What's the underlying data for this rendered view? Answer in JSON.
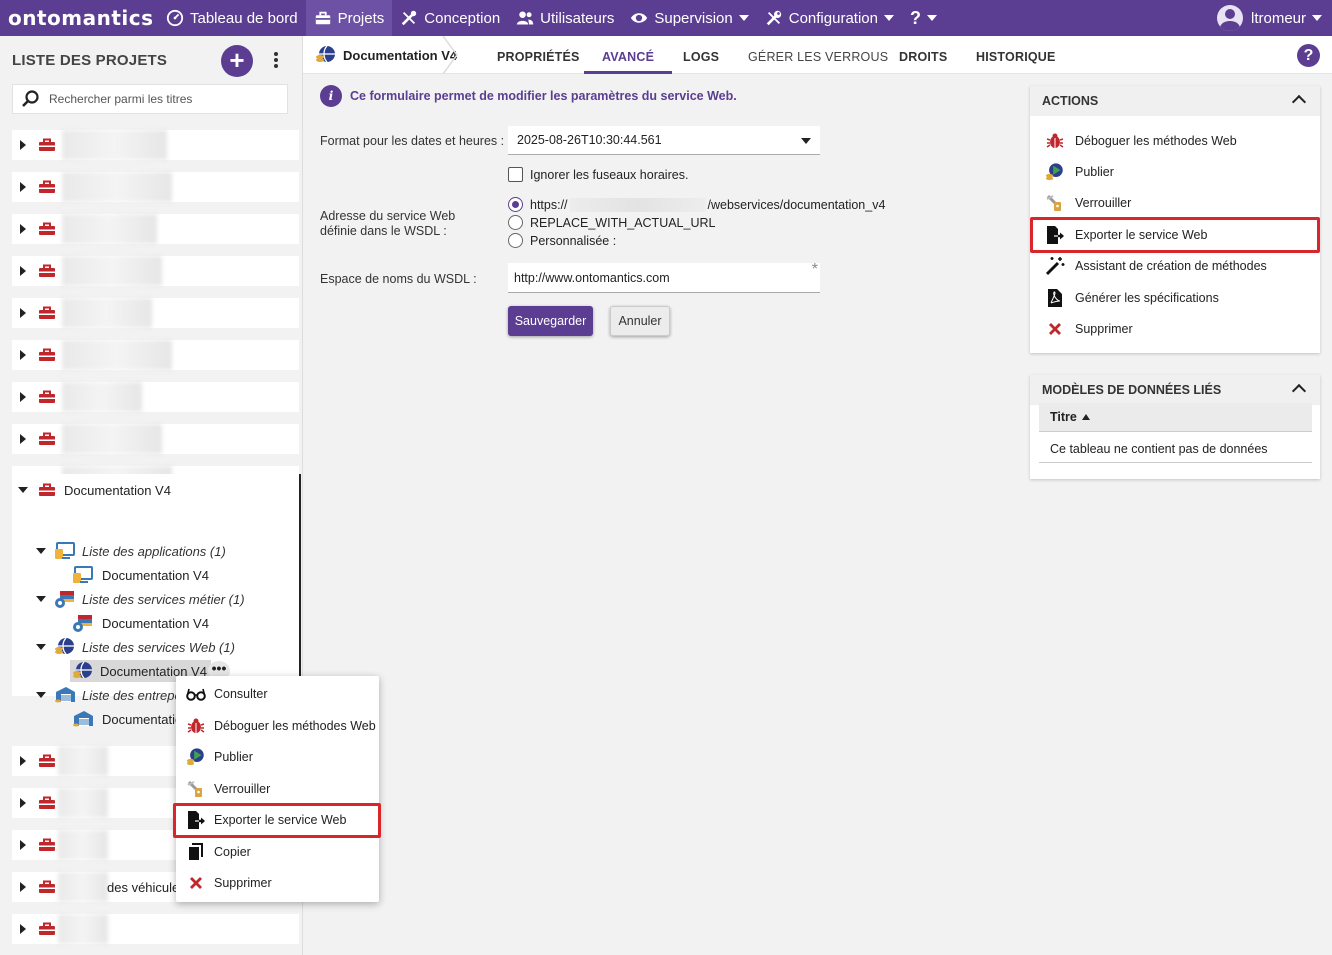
{
  "topbar": {
    "logo": "ontomantics",
    "nav": [
      {
        "label": "Tableau de bord",
        "icon": "dashboard-icon"
      },
      {
        "label": "Projets",
        "icon": "toolbox-icon",
        "active": true
      },
      {
        "label": "Conception",
        "icon": "tools-icon"
      },
      {
        "label": "Utilisateurs",
        "icon": "users-icon"
      },
      {
        "label": "Supervision",
        "icon": "eye-icon"
      },
      {
        "label": "Configuration",
        "icon": "wrench-icon"
      },
      {
        "label": "?",
        "icon": "help-icon"
      }
    ],
    "user": "ltromeur"
  },
  "left": {
    "title": "LISTE DES PROJETS",
    "add_label": "+",
    "search_placeholder": "Rechercher parmi les titres",
    "tree": {
      "project": "Documentation V4",
      "apps_group": "Liste des applications (1)",
      "apps_item": "Documentation V4",
      "business_group": "Liste des services métier (1)",
      "business_item": "Documentation V4",
      "web_group": "Liste des services Web (1)",
      "web_item": "Documentation V4",
      "warehouse_group": "Liste des entrepô",
      "warehouse_item": "Documentatio"
    },
    "partial_project_label": "des véhicule"
  },
  "tabs": {
    "crumb": "Documentation V4",
    "items": [
      "PROPRIÉTÉS",
      "AVANCÉ",
      "LOGS",
      "GÉRER LES VERROUS",
      "DROITS",
      "HISTORIQUE"
    ],
    "active": "AVANCÉ",
    "help": "?"
  },
  "form": {
    "info": "Ce formulaire permet de modifier les paramètres du service Web.",
    "date_format_label": "Format pour les dates et heures :",
    "date_format_value": "2025-08-26T10:30:44.561",
    "ignore_tz_label": "Ignorer les fuseaux horaires.",
    "wsdl_address_label_1": "Adresse du service Web",
    "wsdl_address_label_2": "définie dans le WSDL :",
    "radio_https_prefix": "https://",
    "radio_https_suffix": "/webservices/documentation_v4",
    "radio_replace": "REPLACE_WITH_ACTUAL_URL",
    "radio_custom": "Personnalisée :",
    "namespace_label": "Espace de noms du WSDL :",
    "namespace_value": "http://www.ontomantics.com",
    "save": "Sauvegarder",
    "cancel": "Annuler"
  },
  "actions": {
    "title": "ACTIONS",
    "items": [
      {
        "label": "Déboguer les méthodes Web",
        "icon": "bug-icon"
      },
      {
        "label": "Publier",
        "icon": "publish-icon"
      },
      {
        "label": "Verrouiller",
        "icon": "key-icon"
      },
      {
        "label": "Exporter le service Web",
        "icon": "export-icon"
      },
      {
        "label": "Assistant de création de méthodes",
        "icon": "magic-wand-icon"
      },
      {
        "label": "Générer les spécifications",
        "icon": "pdf-icon"
      },
      {
        "label": "Supprimer",
        "icon": "delete-icon"
      }
    ]
  },
  "models": {
    "title": "MODÈLES DE DONNÉES LIÉS",
    "column": "Titre",
    "empty": "Ce tableau ne contient pas de données"
  },
  "context_menu": {
    "items": [
      {
        "label": "Consulter",
        "icon": "glasses-icon"
      },
      {
        "label": "Déboguer les méthodes Web",
        "icon": "bug-icon"
      },
      {
        "label": "Publier",
        "icon": "publish-icon"
      },
      {
        "label": "Verrouiller",
        "icon": "key-icon"
      },
      {
        "label": "Exporter le service Web",
        "icon": "export-icon"
      },
      {
        "label": "Copier",
        "icon": "copy-icon"
      },
      {
        "label": "Supprimer",
        "icon": "delete-icon"
      }
    ]
  },
  "colors": {
    "brand": "#5b3d91",
    "highlight": "#d9262d",
    "toolbox": "#c0272d"
  }
}
